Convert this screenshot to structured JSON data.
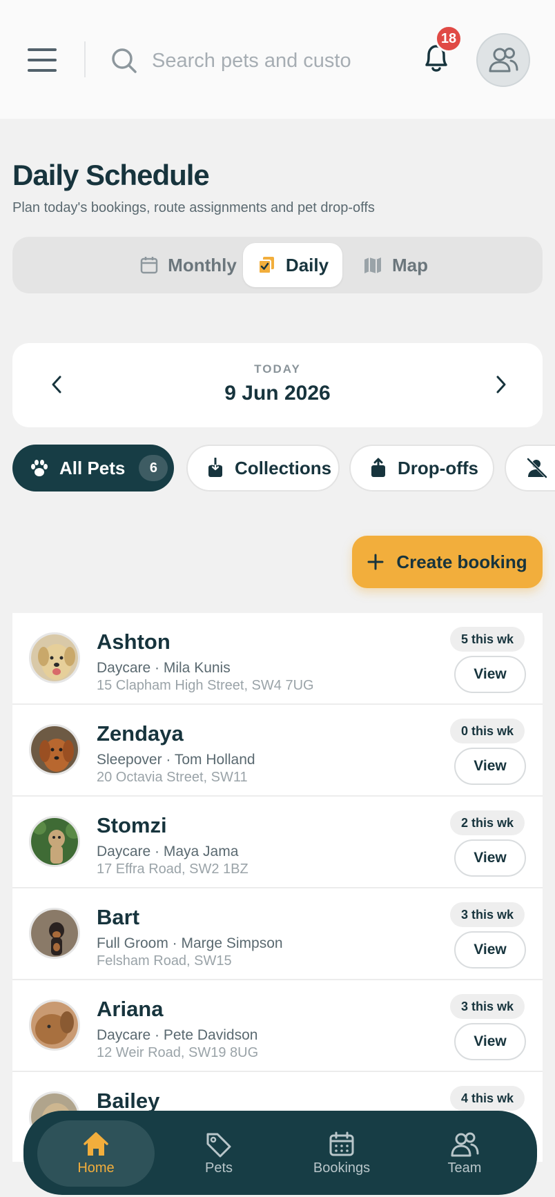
{
  "header": {
    "search_placeholder": "Search pets and customers",
    "notification_count": "18"
  },
  "page": {
    "title": "Daily Schedule",
    "subtitle": "Plan today's bookings, route assignments and pet drop-offs"
  },
  "view_switch": {
    "monthly": "Monthly",
    "daily": "Daily",
    "map": "Map",
    "selected": "Daily"
  },
  "date_nav": {
    "label": "TODAY",
    "date": "9 Jun 2026"
  },
  "filters": {
    "all_pets": "All Pets",
    "all_pets_count": "6",
    "collections": "Collections",
    "dropoffs": "Drop-offs"
  },
  "create_booking": "Create booking",
  "pets": [
    {
      "name": "Ashton",
      "service": "Daycare · Mila Kunis",
      "address": "15 Clapham High Street, SW4 7UG",
      "week": "5 this wk",
      "view": "View"
    },
    {
      "name": "Zendaya",
      "service": "Sleepover · Tom Holland",
      "address": "20 Octavia Street, SW11",
      "week": "0 this wk",
      "view": "View"
    },
    {
      "name": "Stomzi",
      "service": "Daycare · Maya Jama",
      "address": "17 Effra Road, SW2 1BZ",
      "week": "2 this wk",
      "view": "View"
    },
    {
      "name": "Bart",
      "service": "Full Groom · Marge Simpson",
      "address": "Felsham Road, SW15",
      "week": "3 this wk",
      "view": "View"
    },
    {
      "name": "Ariana",
      "service": "Daycare · Pete Davidson",
      "address": "12 Weir Road, SW19 8UG",
      "week": "3 this wk",
      "view": "View"
    },
    {
      "name": "Bailey",
      "service": "",
      "address": "",
      "week": "4 this wk",
      "view": ""
    }
  ],
  "bottom_nav": {
    "home": "Home",
    "pets": "Pets",
    "bookings": "Bookings",
    "team": "Team",
    "active": "Home"
  },
  "colors": {
    "brand_dark": "#173d45",
    "accent": "#f2ae3c",
    "badge_red": "#e04a45"
  },
  "icons": {
    "menu": "hamburger-icon",
    "search": "search-icon",
    "bell": "bell-icon",
    "avatar": "users-icon"
  }
}
